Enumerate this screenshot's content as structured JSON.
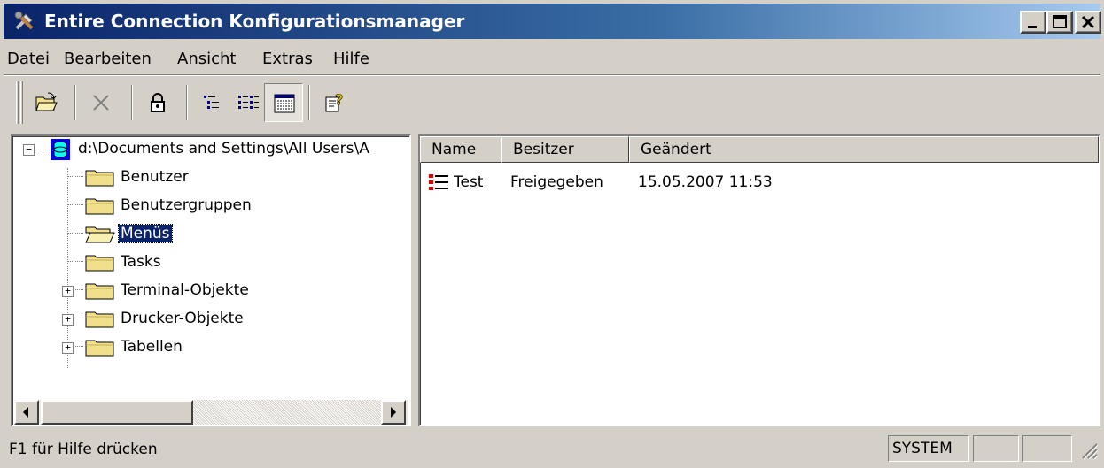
{
  "window": {
    "title": "Entire Connection Konfigurationsmanager",
    "caption_buttons": {
      "minimize": "_",
      "maximize": "□",
      "close": "×"
    }
  },
  "menubar": {
    "items": [
      "Datei",
      "Bearbeiten",
      "Ansicht",
      "Extras",
      "Hilfe"
    ]
  },
  "toolbar": {
    "buttons": [
      {
        "name": "open-folder-icon"
      },
      {
        "name": "delete-icon",
        "disabled": true
      },
      {
        "name": "lock-icon"
      },
      {
        "name": "view-tree-icon"
      },
      {
        "name": "view-list-icon"
      },
      {
        "name": "view-details-icon",
        "pressed": true
      },
      {
        "name": "help-icon"
      }
    ]
  },
  "tree": {
    "root": {
      "label": "d:\\Documents and Settings\\All Users\\A",
      "expanded": true
    },
    "items": [
      {
        "label": "Benutzer",
        "expandable": false,
        "selected": false
      },
      {
        "label": "Benutzergruppen",
        "expandable": false,
        "selected": false
      },
      {
        "label": "Menüs",
        "expandable": false,
        "selected": true,
        "open": true
      },
      {
        "label": "Tasks",
        "expandable": false,
        "selected": false
      },
      {
        "label": "Terminal-Objekte",
        "expandable": true,
        "selected": false
      },
      {
        "label": "Drucker-Objekte",
        "expandable": true,
        "selected": false
      },
      {
        "label": "Tabellen",
        "expandable": true,
        "selected": false
      }
    ]
  },
  "list": {
    "columns": [
      "Name",
      "Besitzer",
      "Geändert"
    ],
    "rows": [
      {
        "name": "Test",
        "owner": "Freigegeben",
        "modified": "15.05.2007 11:53",
        "icon": "menu-list-icon"
      }
    ]
  },
  "statusbar": {
    "text": "F1 für Hilfe drücken",
    "panels": [
      "SYSTEM",
      "",
      ""
    ]
  },
  "colors": {
    "titlebar_start": "#0a246a",
    "titlebar_end": "#a6caf0",
    "selection": "#0a246a",
    "face": "#d4d0c8",
    "folder": "#f0e08c"
  }
}
